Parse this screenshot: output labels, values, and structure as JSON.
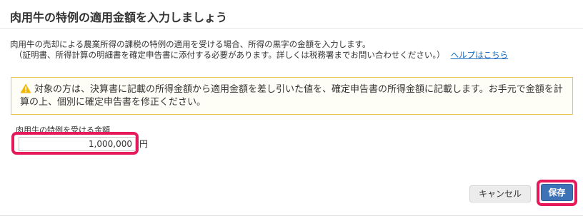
{
  "dialog": {
    "title": "肉用牛の特例の適用金額を入力しましょう",
    "description_line1": "肉用牛の売却による農業所得の課税の特例の適用を受ける場合、所得の黒字の金額を入力します。",
    "description_line2": "（証明書、所得計算の明細書を確定申告書に添付する必要があります。詳しくは税務署までお問い合わせください。）",
    "help_link": "ヘルプはこちら",
    "warning": {
      "icon": "warning-triangle-icon",
      "text": "対象の方は、決算書に記載の所得金額から適用金額を差し引いた値を、確定申告書の所得金額に記載します。お手元で金額を計算の上、個別に確定申告書を修正ください。"
    },
    "field": {
      "label": "肉用牛の特例を受ける金額",
      "value": "1,000,000",
      "unit": "円"
    },
    "buttons": {
      "cancel": "キャンセル",
      "save": "保存"
    }
  },
  "colors": {
    "highlight": "#e6195a",
    "primary_button": "#3d73b6",
    "warning_border": "#e8c84a",
    "link": "#1a6bbf"
  }
}
